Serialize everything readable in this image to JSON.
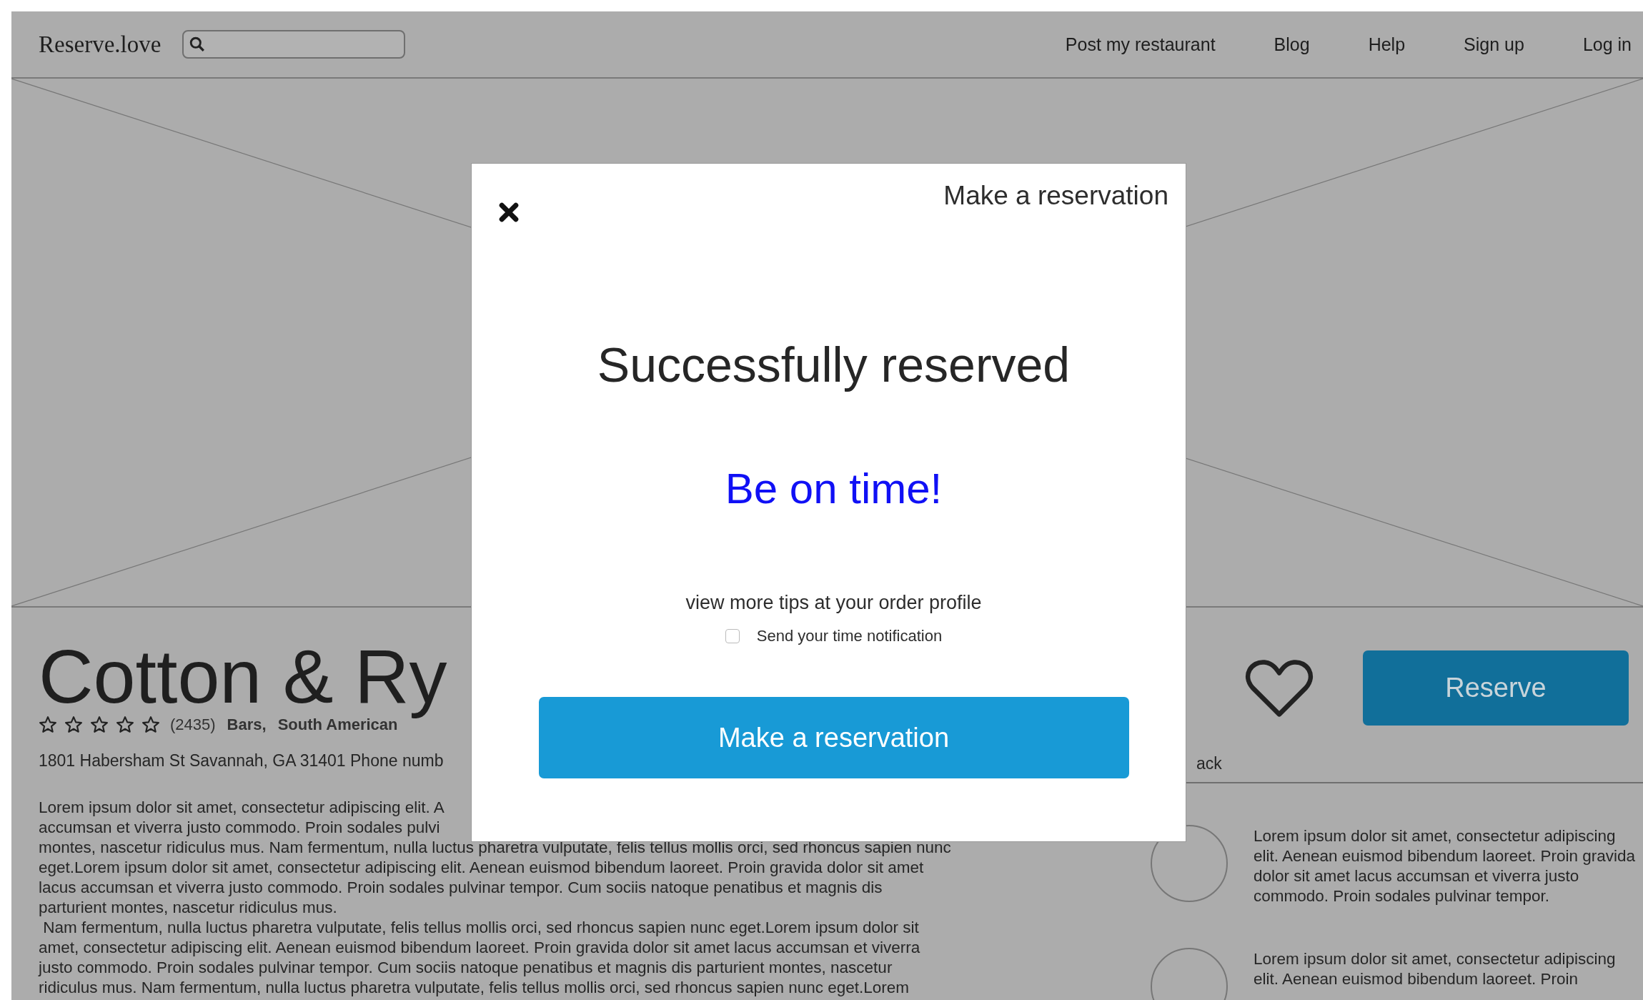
{
  "header": {
    "logo": "Reserve.love",
    "nav": [
      "Post my restaurant",
      "Blog",
      "Help",
      "Sign up",
      "Log in"
    ]
  },
  "restaurant": {
    "name": "Cotton & Ry",
    "stars": 0,
    "review_count": "(2435)",
    "categories": [
      "Bars,",
      "South American"
    ],
    "address": "1801 Habersham St Savannah, GA 31401  Phone numb",
    "description_lines": [
      "Lorem ipsum dolor sit amet, consectetur adipiscing elit. A",
      "accumsan et viverra justo commodo. Proin sodales pulvi",
      "montes, nascetur ridiculus mus. Nam fermentum, nulla luctus pharetra vulputate, felis tellus mollis orci, sed rhoncus sapien nunc",
      "eget.Lorem ipsum dolor sit amet, consectetur adipiscing elit. Aenean euismod bibendum laoreet. Proin gravida dolor sit amet",
      "lacus accumsan et viverra justo commodo. Proin sodales pulvinar tempor. Cum sociis natoque penatibus et magnis dis",
      "parturient montes, nascetur ridiculus mus.",
      " Nam fermentum, nulla luctus pharetra vulputate, felis tellus mollis orci, sed rhoncus sapien nunc eget.Lorem ipsum dolor sit",
      "amet, consectetur adipiscing elit. Aenean euismod bibendum laoreet. Proin gravida dolor sit amet lacus accumsan et viverra",
      "justo commodo. Proin sodales pulvinar tempor. Cum sociis natoque penatibus et magnis dis parturient montes, nascetur",
      "ridiculus mus. Nam fermentum, nulla luctus pharetra vulputate, felis tellus mollis orci, sed rhoncus sapien nunc eget.Lorem"
    ]
  },
  "actions": {
    "favorite": false,
    "reserve_button": "Reserve",
    "tab_fragment": "ack"
  },
  "reviews": [
    {
      "text": "Lorem ipsum dolor sit amet, consectetur adipiscing elit. Aenean euismod bibendum laoreet. Proin gravida dolor sit amet lacus accumsan et viverra justo commodo. Proin sodales pulvinar tempor."
    },
    {
      "text": "Lorem ipsum dolor sit amet, consectetur adipiscing elit. Aenean euismod bibendum laoreet. Proin"
    }
  ],
  "modal": {
    "title": "Make a reservation",
    "heading": "Successfully reserved",
    "message": "Be on time!",
    "tip": "view more tips at your order profile",
    "notification": {
      "label": "Send your time notification",
      "checked": false
    },
    "button": "Make a reservation"
  }
}
